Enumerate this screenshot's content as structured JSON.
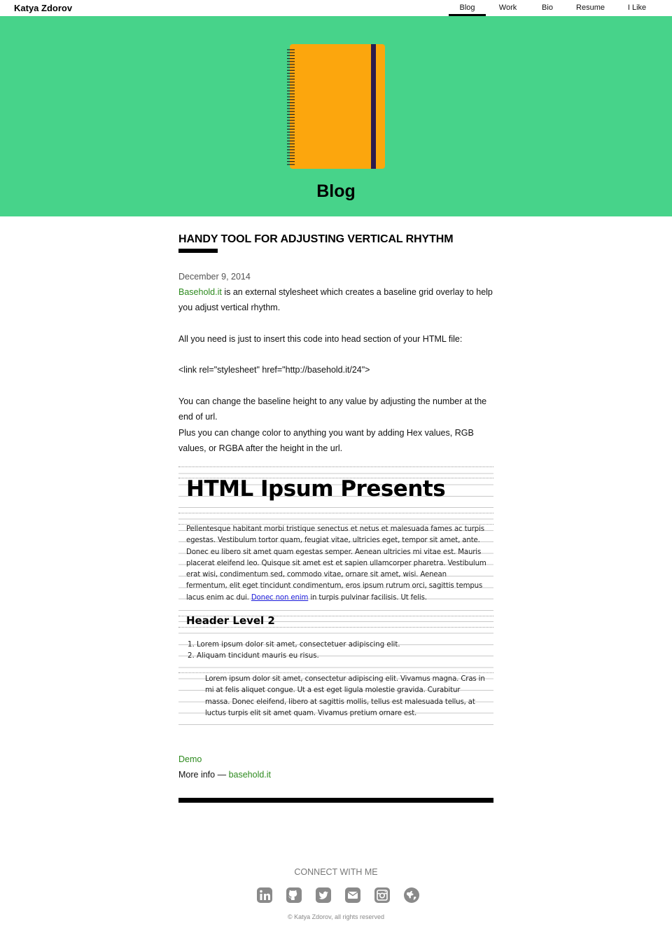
{
  "site": {
    "brand": "Katya Zdorov"
  },
  "nav": {
    "items": [
      {
        "label": "Blog",
        "active": true
      },
      {
        "label": "Work",
        "active": false
      },
      {
        "label": "Bio",
        "active": false
      },
      {
        "label": "Resume",
        "active": false
      },
      {
        "label": "I Like",
        "active": false
      }
    ]
  },
  "hero": {
    "title": "Blog",
    "icon": "notebook-icon",
    "bg_color": "#47d38a",
    "notebook_color": "#fca60d",
    "band_color": "#2d1b4e"
  },
  "post": {
    "title": "HANDY TOOL FOR ADJUSTING VERTICAL RHYTHM",
    "date": "December 9, 2014",
    "intro_link": "Basehold.it",
    "intro_text": " is an external stylesheet which creates a baseline grid overlay to help you adjust vertical rhythm.",
    "para2": "All you need is just to insert this code into head section of your HTML file:",
    "code": "<link rel=\"stylesheet\" href=\"http://basehold.it/24\">",
    "para3": "You can change the baseline height to any value by adjusting the number at the end of url.",
    "para4": "Plus you can change color to anything you want by adding Hex values, RGB values, or RGBA after the height in the url.",
    "demo_link": "Demo",
    "more_info_label": "More info — ",
    "more_info_link": "basehold.it",
    "link_color": "#2d8a1e"
  },
  "demo": {
    "h1": "HTML Ipsum Presents",
    "paragraph_before_link": "Pellentesque habitant morbi tristique senectus et netus et malesuada fames ac turpis egestas. Vestibulum tortor quam, feugiat vitae, ultricies eget, tempor sit amet, ante. Donec eu libero sit amet quam egestas semper. Aenean ultricies mi vitae est. Mauris placerat eleifend leo. Quisque sit amet est et sapien ullamcorper pharetra. Vestibulum erat wisi, condimentum sed, commodo vitae, ornare sit amet, wisi. Aenean fermentum, elit eget tincidunt condimentum, eros ipsum rutrum orci, sagittis tempus lacus enim ac dui. ",
    "paragraph_link": "Donec non enim",
    "paragraph_after_link": " in turpis pulvinar facilisis. Ut felis.",
    "h2": "Header Level 2",
    "list": [
      "Lorem ipsum dolor sit amet, consectetuer adipiscing elit.",
      "Aliquam tincidunt mauris eu risus."
    ],
    "quote": "Lorem ipsum dolor sit amet, consectetur adipiscing elit. Vivamus magna. Cras in mi at felis aliquet congue. Ut a est eget ligula molestie gravida. Curabitur massa. Donec eleifend, libero at sagittis mollis, tellus est malesuada tellus, at luctus turpis elit sit amet quam. Vivamus pretium ornare est."
  },
  "footer": {
    "connect_label": "CONNECT WITH ME",
    "socials": [
      "linkedin-icon",
      "github-icon",
      "twitter-icon",
      "email-icon",
      "instagram-icon",
      "globe-icon"
    ],
    "copyright": "© Katya Zdorov, all rights reserved",
    "icon_color": "#8a8a8a"
  }
}
